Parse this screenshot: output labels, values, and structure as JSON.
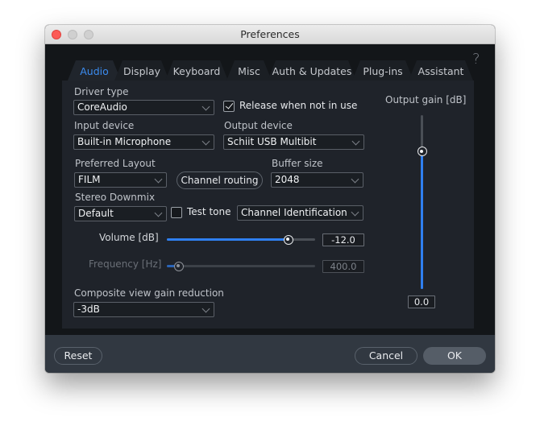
{
  "window": {
    "title": "Preferences",
    "help_icon": "?"
  },
  "tabs": [
    {
      "label": "Audio",
      "active": true
    },
    {
      "label": "Display",
      "active": false
    },
    {
      "label": "Keyboard",
      "active": false
    },
    {
      "label": "Misc",
      "active": false
    },
    {
      "label": "Auth & Updates",
      "active": false
    },
    {
      "label": "Plug-ins",
      "active": false
    },
    {
      "label": "Assistant",
      "active": false
    }
  ],
  "audio": {
    "driver_type": {
      "label": "Driver type",
      "value": "CoreAudio"
    },
    "release_when_not_in_use": {
      "label": "Release when not in use",
      "checked": true
    },
    "input_device": {
      "label": "Input device",
      "value": "Built-in Microphone"
    },
    "output_device": {
      "label": "Output device",
      "value": "Schiit USB Multibit"
    },
    "preferred_layout": {
      "label": "Preferred Layout",
      "value": "FILM"
    },
    "channel_routing_button": "Channel routing",
    "buffer_size": {
      "label": "Buffer size",
      "value": "2048"
    },
    "stereo_downmix": {
      "label": "Stereo Downmix",
      "value": "Default"
    },
    "test_tone": {
      "label": "Test tone",
      "checked": false
    },
    "test_tone_signal": {
      "value": "Channel Identification"
    },
    "volume": {
      "label": "Volume [dB]",
      "value": "-12.0",
      "slider_fraction": 0.82
    },
    "frequency": {
      "label": "Frequency [Hz]",
      "value": "400.0",
      "slider_fraction": 0.08,
      "disabled": true
    },
    "composite_view_gain_reduction": {
      "label": "Composite view gain reduction",
      "value": "-3dB"
    },
    "output_gain": {
      "label": "Output gain [dB]",
      "value": "0.0",
      "slider_fraction": 0.79
    }
  },
  "footer": {
    "reset": "Reset",
    "cancel": "Cancel",
    "ok": "OK"
  },
  "colors": {
    "accent": "#2f7ff0",
    "active_tab_text": "#3b8cf0",
    "panel_bg": "#1f232a",
    "window_bg": "#131619",
    "footer_bg": "#313841"
  }
}
